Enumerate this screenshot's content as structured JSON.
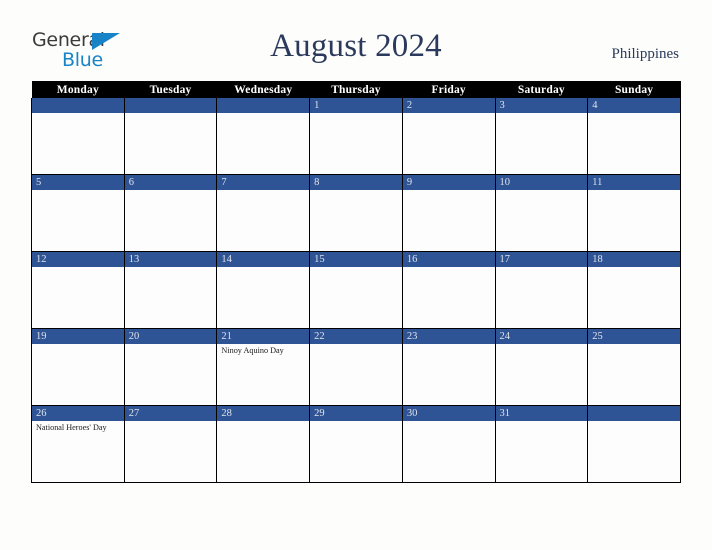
{
  "logo": {
    "word_one": "General",
    "word_two": "Blue",
    "triangle": "blue-triangle-icon"
  },
  "header": {
    "title": "August 2024",
    "country": "Philippines"
  },
  "colors": {
    "accent_blue": "#2f5496",
    "logo_blue": "#1884c7",
    "header_black": "#000000",
    "title_navy": "#2b3a5c",
    "page_background": "#fdfdfc"
  },
  "calendar": {
    "weekday_headers": [
      "Monday",
      "Tuesday",
      "Wednesday",
      "Thursday",
      "Friday",
      "Saturday",
      "Sunday"
    ],
    "weeks": [
      [
        {
          "day": "",
          "events": []
        },
        {
          "day": "",
          "events": []
        },
        {
          "day": "",
          "events": []
        },
        {
          "day": "1",
          "events": []
        },
        {
          "day": "2",
          "events": []
        },
        {
          "day": "3",
          "events": []
        },
        {
          "day": "4",
          "events": []
        }
      ],
      [
        {
          "day": "5",
          "events": []
        },
        {
          "day": "6",
          "events": []
        },
        {
          "day": "7",
          "events": []
        },
        {
          "day": "8",
          "events": []
        },
        {
          "day": "9",
          "events": []
        },
        {
          "day": "10",
          "events": []
        },
        {
          "day": "11",
          "events": []
        }
      ],
      [
        {
          "day": "12",
          "events": []
        },
        {
          "day": "13",
          "events": []
        },
        {
          "day": "14",
          "events": []
        },
        {
          "day": "15",
          "events": []
        },
        {
          "day": "16",
          "events": []
        },
        {
          "day": "17",
          "events": []
        },
        {
          "day": "18",
          "events": []
        }
      ],
      [
        {
          "day": "19",
          "events": []
        },
        {
          "day": "20",
          "events": []
        },
        {
          "day": "21",
          "events": [
            "Ninoy Aquino Day"
          ]
        },
        {
          "day": "22",
          "events": []
        },
        {
          "day": "23",
          "events": []
        },
        {
          "day": "24",
          "events": []
        },
        {
          "day": "25",
          "events": []
        }
      ],
      [
        {
          "day": "26",
          "events": [
            "National Heroes' Day"
          ]
        },
        {
          "day": "27",
          "events": []
        },
        {
          "day": "28",
          "events": []
        },
        {
          "day": "29",
          "events": []
        },
        {
          "day": "30",
          "events": []
        },
        {
          "day": "31",
          "events": []
        },
        {
          "day": "",
          "events": []
        }
      ]
    ]
  }
}
